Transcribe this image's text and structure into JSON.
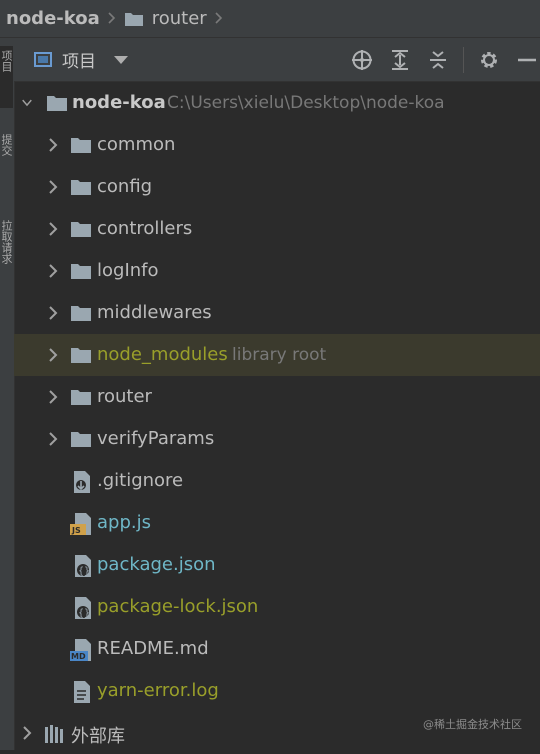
{
  "breadcrumb": {
    "project": "node-koa",
    "folder": "router"
  },
  "leftstrip": {
    "tabs": [
      "项目",
      "提交",
      "拉取请求"
    ]
  },
  "panel": {
    "title": "项目"
  },
  "tree": {
    "root": {
      "name": "node-koa",
      "path": "C:\\Users\\xielu\\Desktop\\node-koa"
    },
    "folders": [
      {
        "name": "common"
      },
      {
        "name": "config"
      },
      {
        "name": "controllers"
      },
      {
        "name": "logInfo"
      },
      {
        "name": "middlewares"
      },
      {
        "name": "node_modules",
        "suffix": "library root"
      },
      {
        "name": "router"
      },
      {
        "name": "verifyParams"
      }
    ],
    "files": [
      {
        "name": ".gitignore",
        "icon": "gitignore-file-icon",
        "color": "#bbbbbb"
      },
      {
        "name": "app.js",
        "icon": "js-file-icon",
        "color": "#6fb7c7"
      },
      {
        "name": "package.json",
        "icon": "json-file-icon",
        "color": "#6fb7c7"
      },
      {
        "name": "package-lock.json",
        "icon": "json-file-icon",
        "color": "#999f2a"
      },
      {
        "name": "README.md",
        "icon": "markdown-file-icon",
        "color": "#bbbbbb"
      },
      {
        "name": "yarn-error.log",
        "icon": "log-file-icon",
        "color": "#999f2a"
      }
    ],
    "external": {
      "name": "外部库"
    }
  },
  "colors": {
    "library_text": "#999f2a",
    "modified_text": "#6fb7c7",
    "highlight_row": "#3b3a2d"
  },
  "watermark": "@稀土掘金技术社区"
}
